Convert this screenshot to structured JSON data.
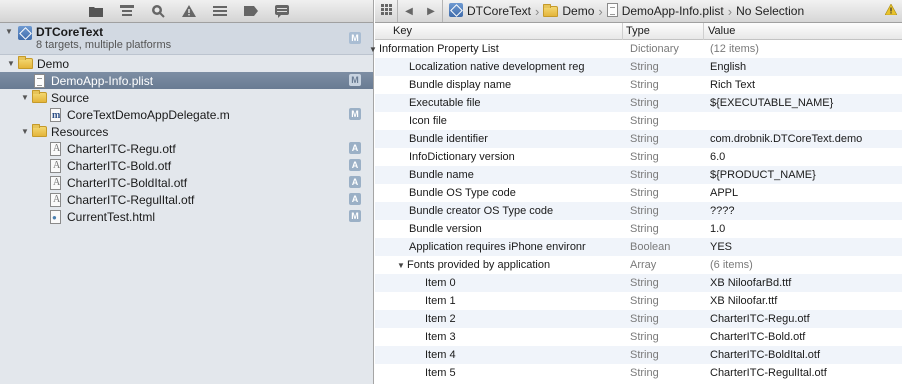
{
  "navigator": {
    "project": {
      "name": "DTCoreText",
      "subtitle": "8 targets, multiple platforms",
      "badge": "M"
    },
    "items": [
      {
        "label": "Demo",
        "kind": "folder",
        "level": 1,
        "disclosure": "▼",
        "badge": ""
      },
      {
        "label": "DemoApp-Info.plist",
        "kind": "plist",
        "level": 2,
        "disclosure": "",
        "badge": "M",
        "selected": true
      },
      {
        "label": "Source",
        "kind": "folder",
        "level": 2,
        "disclosure": "▼",
        "badge": ""
      },
      {
        "label": "CoreTextDemoAppDelegate.m",
        "kind": "m",
        "level": 3,
        "disclosure": "",
        "badge": "M"
      },
      {
        "label": "Resources",
        "kind": "folder",
        "level": 2,
        "disclosure": "▼",
        "badge": ""
      },
      {
        "label": "CharterITC-Regu.otf",
        "kind": "font",
        "level": 3,
        "disclosure": "",
        "badge": "A"
      },
      {
        "label": "CharterITC-Bold.otf",
        "kind": "font",
        "level": 3,
        "disclosure": "",
        "badge": "A"
      },
      {
        "label": "CharterITC-BoldItal.otf",
        "kind": "font",
        "level": 3,
        "disclosure": "",
        "badge": "A"
      },
      {
        "label": "CharterITC-RegulItal.otf",
        "kind": "font",
        "level": 3,
        "disclosure": "",
        "badge": "A"
      },
      {
        "label": "CurrentTest.html",
        "kind": "html",
        "level": 3,
        "disclosure": "",
        "badge": "M"
      }
    ]
  },
  "jumpbar": {
    "crumbs": [
      "DTCoreText",
      "Demo",
      "DemoApp-Info.plist",
      "No Selection"
    ]
  },
  "plist": {
    "columns": {
      "key": "Key",
      "type": "Type",
      "value": "Value"
    },
    "rows": [
      {
        "key": "Information Property List",
        "type": "Dictionary",
        "value": "(12 items)",
        "level": 0,
        "disclosure": "▼",
        "muted": true
      },
      {
        "key": "Localization native development reg",
        "type": "String",
        "value": "English",
        "level": 1
      },
      {
        "key": "Bundle display name",
        "type": "String",
        "value": "Rich Text",
        "level": 1
      },
      {
        "key": "Executable file",
        "type": "String",
        "value": "${EXECUTABLE_NAME}",
        "level": 1
      },
      {
        "key": "Icon file",
        "type": "String",
        "value": "",
        "level": 1
      },
      {
        "key": "Bundle identifier",
        "type": "String",
        "value": "com.drobnik.DTCoreText.demo",
        "level": 1
      },
      {
        "key": "InfoDictionary version",
        "type": "String",
        "value": "6.0",
        "level": 1
      },
      {
        "key": "Bundle name",
        "type": "String",
        "value": "${PRODUCT_NAME}",
        "level": 1
      },
      {
        "key": "Bundle OS Type code",
        "type": "String",
        "value": "APPL",
        "level": 1
      },
      {
        "key": "Bundle creator OS Type code",
        "type": "String",
        "value": "????",
        "level": 1
      },
      {
        "key": "Bundle version",
        "type": "String",
        "value": "1.0",
        "level": 1
      },
      {
        "key": "Application requires iPhone environr",
        "type": "Boolean",
        "value": "YES",
        "level": 1
      },
      {
        "key": "Fonts provided by application",
        "type": "Array",
        "value": "(6 items)",
        "level": 1,
        "disclosure": "▼",
        "muted": true
      },
      {
        "key": "Item 0",
        "type": "String",
        "value": "XB NiloofarBd.ttf",
        "level": 2
      },
      {
        "key": "Item 1",
        "type": "String",
        "value": "XB Niloofar.ttf",
        "level": 2
      },
      {
        "key": "Item 2",
        "type": "String",
        "value": "CharterITC-Regu.otf",
        "level": 2
      },
      {
        "key": "Item 3",
        "type": "String",
        "value": "CharterITC-Bold.otf",
        "level": 2
      },
      {
        "key": "Item 4",
        "type": "String",
        "value": "CharterITC-BoldItal.otf",
        "level": 2
      },
      {
        "key": "Item 5",
        "type": "String",
        "value": "CharterITC-RegulItal.otf",
        "level": 2
      }
    ]
  }
}
